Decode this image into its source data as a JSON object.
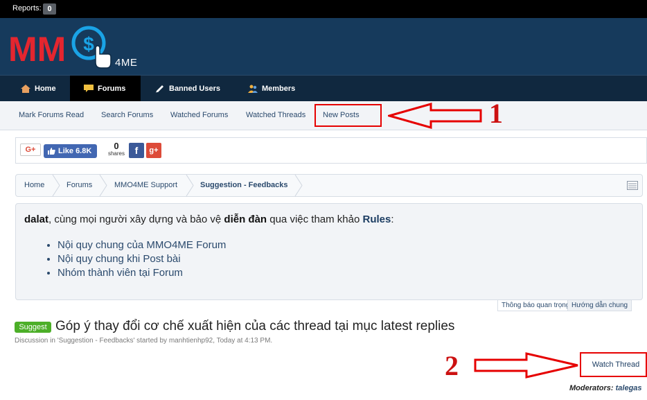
{
  "topbar": {
    "reports_label": "Reports:",
    "reports_count": "0"
  },
  "logo": {
    "mm_text": "MM",
    "dollar_symbol": "$",
    "suffix": "4ME"
  },
  "nav": {
    "items": [
      {
        "label": "Home",
        "icon": "home-icon"
      },
      {
        "label": "Forums",
        "icon": "chat-icon"
      },
      {
        "label": "Banned Users",
        "icon": "pencil-icon"
      },
      {
        "label": "Members",
        "icon": "members-icon"
      }
    ]
  },
  "subnav": {
    "items": [
      {
        "label": "Mark Forums Read"
      },
      {
        "label": "Search Forums"
      },
      {
        "label": "Watched Forums"
      },
      {
        "label": "Watched Threads"
      },
      {
        "label": "New Posts"
      }
    ]
  },
  "annotations": {
    "num1": "1",
    "num2": "2"
  },
  "share": {
    "gplus_label": "G+",
    "like_label": "Like 6.8K",
    "share_count": "0",
    "share_label": "shares",
    "fb_label": "f",
    "gp_label": "g+"
  },
  "breadcrumb": {
    "items": [
      {
        "label": "Home"
      },
      {
        "label": "Forums"
      },
      {
        "label": "MMO4ME Support"
      },
      {
        "label": "Suggestion - Feedbacks"
      }
    ]
  },
  "notice": {
    "user": "dalat",
    "text_1": ", cùng mọi người xây dựng và bảo vệ ",
    "forum_word": "diễn đàn",
    "text_2": " qua việc tham khảo ",
    "rules": "Rules",
    "text_3": ":",
    "links": [
      {
        "label": "Nội quy chung của MMO4ME Forum"
      },
      {
        "label": "Nội quy chung khi Post bài"
      },
      {
        "label": "Nhóm thành viên tại Forum"
      }
    ],
    "tabs": [
      {
        "label": "Thông báo quan trọng"
      },
      {
        "label": "Hướng dẫn chung"
      }
    ]
  },
  "thread": {
    "prefix": "Suggest",
    "title": "Góp ý thay đổi cơ chế xuất hiện của các thread tại mục latest replies",
    "meta": "Discussion in 'Suggestion - Feedbacks' started by manhtienhp92, Today at 4:13 PM.",
    "watch_label": "Watch Thread",
    "moderators_label": "Moderators:",
    "moderator_name": "talegas"
  },
  "colors": {
    "header_bg": "#163a5c",
    "nav_bg": "#10283f",
    "annotation_red": "#e60000",
    "prefix_green": "#4caf28"
  }
}
